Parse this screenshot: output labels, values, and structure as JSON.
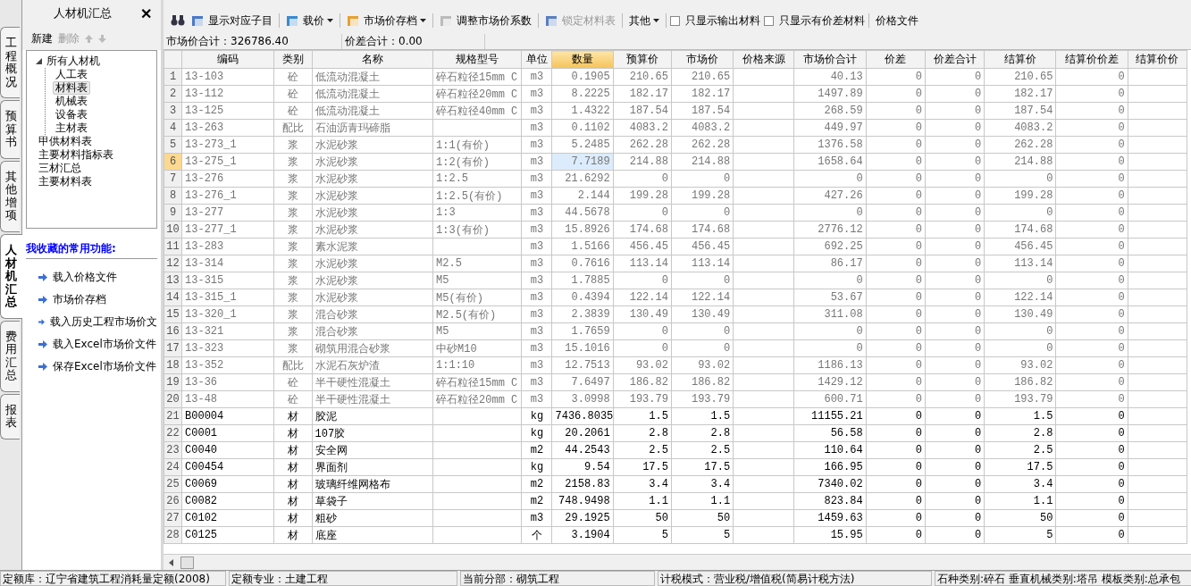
{
  "side_tabs": [
    {
      "label": "工程概况",
      "selected": false
    },
    {
      "label": "预算书",
      "selected": false
    },
    {
      "label": "其他增项",
      "selected": false
    },
    {
      "label": "人材机汇总",
      "selected": true
    },
    {
      "label": "费用汇总",
      "selected": false
    },
    {
      "label": "报表",
      "selected": false
    }
  ],
  "left_panel": {
    "title": "人材机汇总",
    "close": "✕",
    "actions": [
      {
        "label": "新建",
        "disabled": false
      },
      {
        "label": "删除",
        "disabled": true
      }
    ],
    "tree": [
      {
        "label": "所有人材机",
        "selected": false,
        "expanded": true,
        "children": [
          {
            "label": "人工表",
            "selected": false
          },
          {
            "label": "材料表",
            "selected": true
          },
          {
            "label": "机械表",
            "selected": false
          },
          {
            "label": "设备表",
            "selected": false
          },
          {
            "label": "主材表",
            "selected": false
          }
        ]
      },
      {
        "label": "甲供材料表",
        "selected": false
      },
      {
        "label": "主要材料指标表",
        "selected": false
      },
      {
        "label": "三材汇总",
        "selected": false
      },
      {
        "label": "主要材料表",
        "selected": false
      }
    ],
    "favorites_title": "我收藏的常用功能:",
    "favorites": [
      "载入价格文件",
      "市场价存档",
      "载入历史工程市场价文",
      "载入Excel市场价文件",
      "保存Excel市场价文件"
    ]
  },
  "toolbar": [
    {
      "kind": "icon"
    },
    {
      "kind": "button",
      "label": "显示对应子目",
      "disabled": false
    },
    {
      "kind": "dropdown",
      "label": "载价",
      "disabled": false
    },
    {
      "kind": "dropdown",
      "label": "市场价存档",
      "disabled": false
    },
    {
      "kind": "button",
      "label": "调整市场价系数",
      "disabled": false
    },
    {
      "kind": "button",
      "label": "锁定材料表",
      "disabled": true
    },
    {
      "kind": "dropdown",
      "label": "其他",
      "disabled": false
    },
    {
      "kind": "checkbox",
      "label": "只显示输出材料",
      "checked": false
    },
    {
      "kind": "checkbox",
      "label": "只显示有价差材料",
      "checked": false
    },
    {
      "kind": "text",
      "label": "价格文件"
    }
  ],
  "summary": [
    "市场价合计：326786.40",
    "价差合计：0.00"
  ],
  "table": {
    "columns": [
      {
        "label": "编码",
        "selected": false
      },
      {
        "label": "类别",
        "selected": false
      },
      {
        "label": "名称",
        "selected": false
      },
      {
        "label": "规格型号",
        "selected": false
      },
      {
        "label": "单位",
        "selected": false
      },
      {
        "label": "数量",
        "selected": true
      },
      {
        "label": "预算价",
        "selected": false
      },
      {
        "label": "市场价",
        "selected": false
      },
      {
        "label": "价格来源",
        "selected": false
      },
      {
        "label": "市场价合计",
        "selected": false
      },
      {
        "label": "价差",
        "selected": false
      },
      {
        "label": "价差合计",
        "selected": false
      },
      {
        "label": "结算价",
        "selected": false
      },
      {
        "label": "结算价价差",
        "selected": false
      },
      {
        "label": "结算价价",
        "selected": false
      }
    ],
    "rows": [
      {
        "num": "1",
        "kind": "derived",
        "selected": false,
        "cells": [
          "13-103",
          "砼",
          "低流动混凝土",
          "碎石粒径15mm C",
          "m3",
          "0.1905",
          "210.65",
          "210.65",
          null,
          "40.13",
          "0",
          "0",
          "210.65",
          "0",
          null
        ]
      },
      {
        "num": "2",
        "kind": "derived",
        "selected": false,
        "cells": [
          "13-112",
          "砼",
          "低流动混凝土",
          "碎石粒径20mm C",
          "m3",
          "8.2225",
          "182.17",
          "182.17",
          null,
          "1497.89",
          "0",
          "0",
          "182.17",
          "0",
          null
        ]
      },
      {
        "num": "3",
        "kind": "derived",
        "selected": false,
        "cells": [
          "13-125",
          "砼",
          "低流动混凝土",
          "碎石粒径40mm C",
          "m3",
          "1.4322",
          "187.54",
          "187.54",
          null,
          "268.59",
          "0",
          "0",
          "187.54",
          "0",
          null
        ]
      },
      {
        "num": "4",
        "kind": "derived",
        "selected": false,
        "cells": [
          "13-263",
          "配比",
          "石油沥青玛碲脂",
          null,
          "m3",
          "0.1102",
          "4083.2",
          "4083.2",
          null,
          "449.97",
          "0",
          "0",
          "4083.2",
          "0",
          null
        ]
      },
      {
        "num": "5",
        "kind": "derived",
        "selected": false,
        "cells": [
          "13-273_1",
          "浆",
          "水泥砂浆",
          "1:1(有价)",
          "m3",
          "5.2485",
          "262.28",
          "262.28",
          null,
          "1376.58",
          "0",
          "0",
          "262.28",
          "0",
          null
        ]
      },
      {
        "num": "6",
        "kind": "derived",
        "selected": true,
        "cells": [
          "13-275_1",
          "浆",
          "水泥砂浆",
          "1:2(有价)",
          "m3",
          "7.7189",
          "214.88",
          "214.88",
          null,
          "1658.64",
          "0",
          "0",
          "214.88",
          "0",
          null
        ]
      },
      {
        "num": "7",
        "kind": "derived",
        "selected": false,
        "cells": [
          "13-276",
          "浆",
          "水泥砂浆",
          "1:2.5",
          "m3",
          "21.6292",
          "0",
          "0",
          null,
          "0",
          "0",
          "0",
          "0",
          "0",
          null
        ]
      },
      {
        "num": "8",
        "kind": "derived",
        "selected": false,
        "cells": [
          "13-276_1",
          "浆",
          "水泥砂浆",
          "1:2.5(有价)",
          "m3",
          "2.144",
          "199.28",
          "199.28",
          null,
          "427.26",
          "0",
          "0",
          "199.28",
          "0",
          null
        ]
      },
      {
        "num": "9",
        "kind": "derived",
        "selected": false,
        "cells": [
          "13-277",
          "浆",
          "水泥砂浆",
          "1:3",
          "m3",
          "44.5678",
          "0",
          "0",
          null,
          "0",
          "0",
          "0",
          "0",
          "0",
          null
        ]
      },
      {
        "num": "10",
        "kind": "derived",
        "selected": false,
        "cells": [
          "13-277_1",
          "浆",
          "水泥砂浆",
          "1:3(有价)",
          "m3",
          "15.8926",
          "174.68",
          "174.68",
          null,
          "2776.12",
          "0",
          "0",
          "174.68",
          "0",
          null
        ]
      },
      {
        "num": "11",
        "kind": "derived",
        "selected": false,
        "cells": [
          "13-283",
          "浆",
          "素水泥浆",
          null,
          "m3",
          "1.5166",
          "456.45",
          "456.45",
          null,
          "692.25",
          "0",
          "0",
          "456.45",
          "0",
          null
        ]
      },
      {
        "num": "12",
        "kind": "derived",
        "selected": false,
        "cells": [
          "13-314",
          "浆",
          "水泥砂浆",
          "M2.5",
          "m3",
          "0.7616",
          "113.14",
          "113.14",
          null,
          "86.17",
          "0",
          "0",
          "113.14",
          "0",
          null
        ]
      },
      {
        "num": "13",
        "kind": "derived",
        "selected": false,
        "cells": [
          "13-315",
          "浆",
          "水泥砂浆",
          "M5",
          "m3",
          "1.7885",
          "0",
          "0",
          null,
          "0",
          "0",
          "0",
          "0",
          "0",
          null
        ]
      },
      {
        "num": "14",
        "kind": "derived",
        "selected": false,
        "cells": [
          "13-315_1",
          "浆",
          "水泥砂浆",
          "M5(有价)",
          "m3",
          "0.4394",
          "122.14",
          "122.14",
          null,
          "53.67",
          "0",
          "0",
          "122.14",
          "0",
          null
        ]
      },
      {
        "num": "15",
        "kind": "derived",
        "selected": false,
        "cells": [
          "13-320_1",
          "浆",
          "混合砂浆",
          "M2.5(有价)",
          "m3",
          "2.3839",
          "130.49",
          "130.49",
          null,
          "311.08",
          "0",
          "0",
          "130.49",
          "0",
          null
        ]
      },
      {
        "num": "16",
        "kind": "derived",
        "selected": false,
        "cells": [
          "13-321",
          "浆",
          "混合砂浆",
          "M5",
          "m3",
          "1.7659",
          "0",
          "0",
          null,
          "0",
          "0",
          "0",
          "0",
          "0",
          null
        ]
      },
      {
        "num": "17",
        "kind": "derived",
        "selected": false,
        "cells": [
          "13-323",
          "浆",
          "砌筑用混合砂浆",
          "中砂M10",
          "m3",
          "15.1016",
          "0",
          "0",
          null,
          "0",
          "0",
          "0",
          "0",
          "0",
          null
        ]
      },
      {
        "num": "18",
        "kind": "derived",
        "selected": false,
        "cells": [
          "13-352",
          "配比",
          "水泥石灰炉渣",
          "1:1:10",
          "m3",
          "12.7513",
          "93.02",
          "93.02",
          null,
          "1186.13",
          "0",
          "0",
          "93.02",
          "0",
          null
        ]
      },
      {
        "num": "19",
        "kind": "derived",
        "selected": false,
        "cells": [
          "13-36",
          "砼",
          "半干硬性混凝土",
          "碎石粒径15mm C",
          "m3",
          "7.6497",
          "186.82",
          "186.82",
          null,
          "1429.12",
          "0",
          "0",
          "186.82",
          "0",
          null
        ]
      },
      {
        "num": "20",
        "kind": "derived",
        "selected": false,
        "cells": [
          "13-48",
          "砼",
          "半干硬性混凝土",
          "碎石粒径20mm C",
          "m3",
          "3.0998",
          "193.79",
          "193.79",
          null,
          "600.71",
          "0",
          "0",
          "193.79",
          "0",
          null
        ]
      },
      {
        "num": "21",
        "kind": "material",
        "selected": false,
        "cells": [
          "B00004",
          "材",
          "胶泥",
          null,
          "kg",
          "7436.8035",
          "1.5",
          "1.5",
          null,
          "11155.21",
          "0",
          "0",
          "1.5",
          "0",
          null
        ]
      },
      {
        "num": "22",
        "kind": "material",
        "selected": false,
        "cells": [
          "C0001",
          "材",
          "107胶",
          null,
          "kg",
          "20.2061",
          "2.8",
          "2.8",
          null,
          "56.58",
          "0",
          "0",
          "2.8",
          "0",
          null
        ]
      },
      {
        "num": "23",
        "kind": "material",
        "selected": false,
        "cells": [
          "C0040",
          "材",
          "安全网",
          null,
          "m2",
          "44.2543",
          "2.5",
          "2.5",
          null,
          "110.64",
          "0",
          "0",
          "2.5",
          "0",
          null
        ]
      },
      {
        "num": "24",
        "kind": "material",
        "selected": false,
        "cells": [
          "C00454",
          "材",
          "界面剂",
          null,
          "kg",
          "9.54",
          "17.5",
          "17.5",
          null,
          "166.95",
          "0",
          "0",
          "17.5",
          "0",
          null
        ]
      },
      {
        "num": "25",
        "kind": "material",
        "selected": false,
        "cells": [
          "C0069",
          "材",
          "玻璃纤维网格布",
          null,
          "m2",
          "2158.83",
          "3.4",
          "3.4",
          null,
          "7340.02",
          "0",
          "0",
          "3.4",
          "0",
          null
        ]
      },
      {
        "num": "26",
        "kind": "material",
        "selected": false,
        "cells": [
          "C0082",
          "材",
          "草袋子",
          null,
          "m2",
          "748.9498",
          "1.1",
          "1.1",
          null,
          "823.84",
          "0",
          "0",
          "1.1",
          "0",
          null
        ]
      },
      {
        "num": "27",
        "kind": "material",
        "selected": false,
        "cells": [
          "C0102",
          "材",
          "粗砂",
          null,
          "m3",
          "29.1925",
          "50",
          "50",
          null,
          "1459.63",
          "0",
          "0",
          "50",
          "0",
          null
        ]
      },
      {
        "num": "28",
        "kind": "material",
        "selected": false,
        "cells": [
          "C0125",
          "材",
          "底座",
          null,
          "个",
          "3.1904",
          "5",
          "5",
          null,
          "15.95",
          "0",
          "0",
          "5",
          "0",
          null
        ]
      }
    ]
  },
  "status_bar": [
    "定额库：辽宁省建筑工程消耗量定额(2008)",
    "定额专业：土建工程",
    "当前分部：砌筑工程",
    "计税模式：营业税/增值税(简易计税方法)",
    "石种类别:碎石 垂直机械类别:塔吊 模板类别:总承包"
  ]
}
